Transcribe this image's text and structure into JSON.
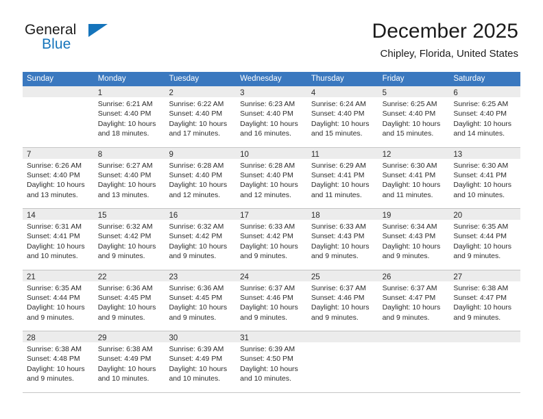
{
  "brand": {
    "name_part1": "General",
    "name_part2": "Blue",
    "triangle_color": "#1574bb"
  },
  "header": {
    "month_title": "December 2025",
    "location": "Chipley, Florida, United States",
    "header_bg_color": "#3a78bf",
    "day_band_color": "#ececec"
  },
  "weekdays": [
    {
      "label": "Sunday"
    },
    {
      "label": "Monday"
    },
    {
      "label": "Tuesday"
    },
    {
      "label": "Wednesday"
    },
    {
      "label": "Thursday"
    },
    {
      "label": "Friday"
    },
    {
      "label": "Saturday"
    }
  ],
  "weeks": [
    {
      "days": [
        {
          "number": "",
          "empty": true,
          "sunrise": "",
          "sunset": "",
          "daylight_line1": "",
          "daylight_line2": ""
        },
        {
          "number": "1",
          "empty": false,
          "sunrise": "Sunrise: 6:21 AM",
          "sunset": "Sunset: 4:40 PM",
          "daylight_line1": "Daylight: 10 hours",
          "daylight_line2": "and 18 minutes."
        },
        {
          "number": "2",
          "empty": false,
          "sunrise": "Sunrise: 6:22 AM",
          "sunset": "Sunset: 4:40 PM",
          "daylight_line1": "Daylight: 10 hours",
          "daylight_line2": "and 17 minutes."
        },
        {
          "number": "3",
          "empty": false,
          "sunrise": "Sunrise: 6:23 AM",
          "sunset": "Sunset: 4:40 PM",
          "daylight_line1": "Daylight: 10 hours",
          "daylight_line2": "and 16 minutes."
        },
        {
          "number": "4",
          "empty": false,
          "sunrise": "Sunrise: 6:24 AM",
          "sunset": "Sunset: 4:40 PM",
          "daylight_line1": "Daylight: 10 hours",
          "daylight_line2": "and 15 minutes."
        },
        {
          "number": "5",
          "empty": false,
          "sunrise": "Sunrise: 6:25 AM",
          "sunset": "Sunset: 4:40 PM",
          "daylight_line1": "Daylight: 10 hours",
          "daylight_line2": "and 15 minutes."
        },
        {
          "number": "6",
          "empty": false,
          "sunrise": "Sunrise: 6:25 AM",
          "sunset": "Sunset: 4:40 PM",
          "daylight_line1": "Daylight: 10 hours",
          "daylight_line2": "and 14 minutes."
        }
      ]
    },
    {
      "days": [
        {
          "number": "7",
          "empty": false,
          "sunrise": "Sunrise: 6:26 AM",
          "sunset": "Sunset: 4:40 PM",
          "daylight_line1": "Daylight: 10 hours",
          "daylight_line2": "and 13 minutes."
        },
        {
          "number": "8",
          "empty": false,
          "sunrise": "Sunrise: 6:27 AM",
          "sunset": "Sunset: 4:40 PM",
          "daylight_line1": "Daylight: 10 hours",
          "daylight_line2": "and 13 minutes."
        },
        {
          "number": "9",
          "empty": false,
          "sunrise": "Sunrise: 6:28 AM",
          "sunset": "Sunset: 4:40 PM",
          "daylight_line1": "Daylight: 10 hours",
          "daylight_line2": "and 12 minutes."
        },
        {
          "number": "10",
          "empty": false,
          "sunrise": "Sunrise: 6:28 AM",
          "sunset": "Sunset: 4:40 PM",
          "daylight_line1": "Daylight: 10 hours",
          "daylight_line2": "and 12 minutes."
        },
        {
          "number": "11",
          "empty": false,
          "sunrise": "Sunrise: 6:29 AM",
          "sunset": "Sunset: 4:41 PM",
          "daylight_line1": "Daylight: 10 hours",
          "daylight_line2": "and 11 minutes."
        },
        {
          "number": "12",
          "empty": false,
          "sunrise": "Sunrise: 6:30 AM",
          "sunset": "Sunset: 4:41 PM",
          "daylight_line1": "Daylight: 10 hours",
          "daylight_line2": "and 11 minutes."
        },
        {
          "number": "13",
          "empty": false,
          "sunrise": "Sunrise: 6:30 AM",
          "sunset": "Sunset: 4:41 PM",
          "daylight_line1": "Daylight: 10 hours",
          "daylight_line2": "and 10 minutes."
        }
      ]
    },
    {
      "days": [
        {
          "number": "14",
          "empty": false,
          "sunrise": "Sunrise: 6:31 AM",
          "sunset": "Sunset: 4:41 PM",
          "daylight_line1": "Daylight: 10 hours",
          "daylight_line2": "and 10 minutes."
        },
        {
          "number": "15",
          "empty": false,
          "sunrise": "Sunrise: 6:32 AM",
          "sunset": "Sunset: 4:42 PM",
          "daylight_line1": "Daylight: 10 hours",
          "daylight_line2": "and 9 minutes."
        },
        {
          "number": "16",
          "empty": false,
          "sunrise": "Sunrise: 6:32 AM",
          "sunset": "Sunset: 4:42 PM",
          "daylight_line1": "Daylight: 10 hours",
          "daylight_line2": "and 9 minutes."
        },
        {
          "number": "17",
          "empty": false,
          "sunrise": "Sunrise: 6:33 AM",
          "sunset": "Sunset: 4:42 PM",
          "daylight_line1": "Daylight: 10 hours",
          "daylight_line2": "and 9 minutes."
        },
        {
          "number": "18",
          "empty": false,
          "sunrise": "Sunrise: 6:33 AM",
          "sunset": "Sunset: 4:43 PM",
          "daylight_line1": "Daylight: 10 hours",
          "daylight_line2": "and 9 minutes."
        },
        {
          "number": "19",
          "empty": false,
          "sunrise": "Sunrise: 6:34 AM",
          "sunset": "Sunset: 4:43 PM",
          "daylight_line1": "Daylight: 10 hours",
          "daylight_line2": "and 9 minutes."
        },
        {
          "number": "20",
          "empty": false,
          "sunrise": "Sunrise: 6:35 AM",
          "sunset": "Sunset: 4:44 PM",
          "daylight_line1": "Daylight: 10 hours",
          "daylight_line2": "and 9 minutes."
        }
      ]
    },
    {
      "days": [
        {
          "number": "21",
          "empty": false,
          "sunrise": "Sunrise: 6:35 AM",
          "sunset": "Sunset: 4:44 PM",
          "daylight_line1": "Daylight: 10 hours",
          "daylight_line2": "and 9 minutes."
        },
        {
          "number": "22",
          "empty": false,
          "sunrise": "Sunrise: 6:36 AM",
          "sunset": "Sunset: 4:45 PM",
          "daylight_line1": "Daylight: 10 hours",
          "daylight_line2": "and 9 minutes."
        },
        {
          "number": "23",
          "empty": false,
          "sunrise": "Sunrise: 6:36 AM",
          "sunset": "Sunset: 4:45 PM",
          "daylight_line1": "Daylight: 10 hours",
          "daylight_line2": "and 9 minutes."
        },
        {
          "number": "24",
          "empty": false,
          "sunrise": "Sunrise: 6:37 AM",
          "sunset": "Sunset: 4:46 PM",
          "daylight_line1": "Daylight: 10 hours",
          "daylight_line2": "and 9 minutes."
        },
        {
          "number": "25",
          "empty": false,
          "sunrise": "Sunrise: 6:37 AM",
          "sunset": "Sunset: 4:46 PM",
          "daylight_line1": "Daylight: 10 hours",
          "daylight_line2": "and 9 minutes."
        },
        {
          "number": "26",
          "empty": false,
          "sunrise": "Sunrise: 6:37 AM",
          "sunset": "Sunset: 4:47 PM",
          "daylight_line1": "Daylight: 10 hours",
          "daylight_line2": "and 9 minutes."
        },
        {
          "number": "27",
          "empty": false,
          "sunrise": "Sunrise: 6:38 AM",
          "sunset": "Sunset: 4:47 PM",
          "daylight_line1": "Daylight: 10 hours",
          "daylight_line2": "and 9 minutes."
        }
      ]
    },
    {
      "days": [
        {
          "number": "28",
          "empty": false,
          "sunrise": "Sunrise: 6:38 AM",
          "sunset": "Sunset: 4:48 PM",
          "daylight_line1": "Daylight: 10 hours",
          "daylight_line2": "and 9 minutes."
        },
        {
          "number": "29",
          "empty": false,
          "sunrise": "Sunrise: 6:38 AM",
          "sunset": "Sunset: 4:49 PM",
          "daylight_line1": "Daylight: 10 hours",
          "daylight_line2": "and 10 minutes."
        },
        {
          "number": "30",
          "empty": false,
          "sunrise": "Sunrise: 6:39 AM",
          "sunset": "Sunset: 4:49 PM",
          "daylight_line1": "Daylight: 10 hours",
          "daylight_line2": "and 10 minutes."
        },
        {
          "number": "31",
          "empty": false,
          "sunrise": "Sunrise: 6:39 AM",
          "sunset": "Sunset: 4:50 PM",
          "daylight_line1": "Daylight: 10 hours",
          "daylight_line2": "and 10 minutes."
        },
        {
          "number": "",
          "empty": true,
          "sunrise": "",
          "sunset": "",
          "daylight_line1": "",
          "daylight_line2": ""
        },
        {
          "number": "",
          "empty": true,
          "sunrise": "",
          "sunset": "",
          "daylight_line1": "",
          "daylight_line2": ""
        },
        {
          "number": "",
          "empty": true,
          "sunrise": "",
          "sunset": "",
          "daylight_line1": "",
          "daylight_line2": ""
        }
      ]
    }
  ]
}
